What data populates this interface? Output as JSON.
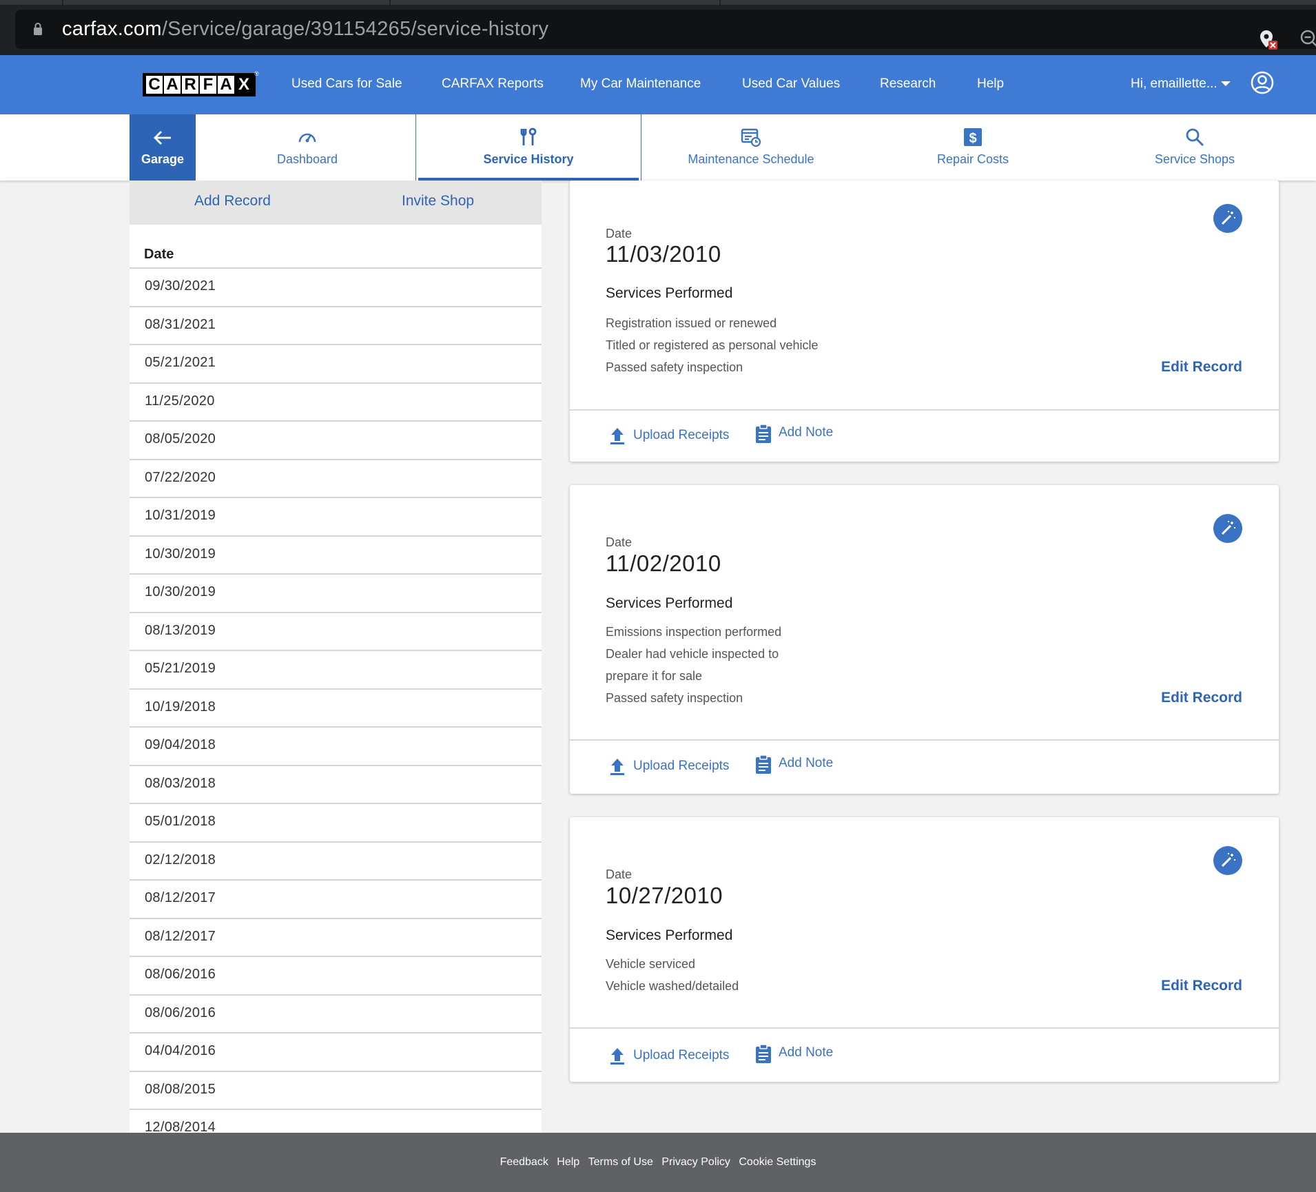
{
  "browser": {
    "url_host": "carfax.com",
    "url_path": "/Service/garage/391154265/service-history",
    "icons": [
      "lock-icon",
      "location-blocked-icon",
      "zoom-icon"
    ]
  },
  "header": {
    "logo_letters": [
      "C",
      "A",
      "R",
      "F",
      "A",
      "X"
    ],
    "logo_reg": "®",
    "nav": {
      "used_cars": "Used Cars for Sale",
      "reports": "CARFAX Reports",
      "maintenance": "My Car Maintenance",
      "values": "Used Car Values",
      "research": "Research",
      "help": "Help"
    },
    "user_greeting": "Hi, emaillette...",
    "brand_color": "#3f7bd4"
  },
  "subnav": {
    "garage": "Garage",
    "dashboard": "Dashboard",
    "service_history": "Service History",
    "maintenance_schedule": "Maintenance Schedule",
    "repair_costs": "Repair Costs",
    "service_shops": "Service Shops",
    "active": "Service History"
  },
  "left_panel": {
    "add_record": "Add Record",
    "invite_shop": "Invite Shop",
    "date_header": "Date",
    "dates": [
      "09/30/2021",
      "08/31/2021",
      "05/21/2021",
      "11/25/2020",
      "08/05/2020",
      "07/22/2020",
      "10/31/2019",
      "10/30/2019",
      "10/30/2019",
      "08/13/2019",
      "05/21/2019",
      "10/19/2018",
      "09/04/2018",
      "08/03/2018",
      "05/01/2018",
      "02/12/2018",
      "08/12/2017",
      "08/12/2017",
      "08/06/2016",
      "08/06/2016",
      "04/04/2016",
      "08/08/2015",
      "12/08/2014"
    ]
  },
  "records": [
    {
      "date_label": "Date",
      "date": "11/03/2010",
      "services_label": "Services Performed",
      "services": [
        "Registration issued or renewed",
        "Titled or registered as personal vehicle",
        "Passed safety inspection"
      ],
      "edit": "Edit Record",
      "upload": "Upload Receipts",
      "note": "Add Note"
    },
    {
      "date_label": "Date",
      "date": "11/02/2010",
      "services_label": "Services Performed",
      "services": [
        "Emissions inspection performed",
        "Dealer had vehicle inspected to",
        "prepare it for sale",
        "Passed safety inspection"
      ],
      "edit": "Edit Record",
      "upload": "Upload Receipts",
      "note": "Add Note"
    },
    {
      "date_label": "Date",
      "date": "10/27/2010",
      "services_label": "Services Performed",
      "services": [
        "Vehicle serviced",
        "Vehicle washed/detailed"
      ],
      "edit": "Edit Record",
      "upload": "Upload Receipts",
      "note": "Add Note"
    }
  ],
  "footer": {
    "links": [
      "Feedback",
      "Help",
      "Terms of Use",
      "Privacy Policy",
      "Cookie Settings"
    ]
  }
}
